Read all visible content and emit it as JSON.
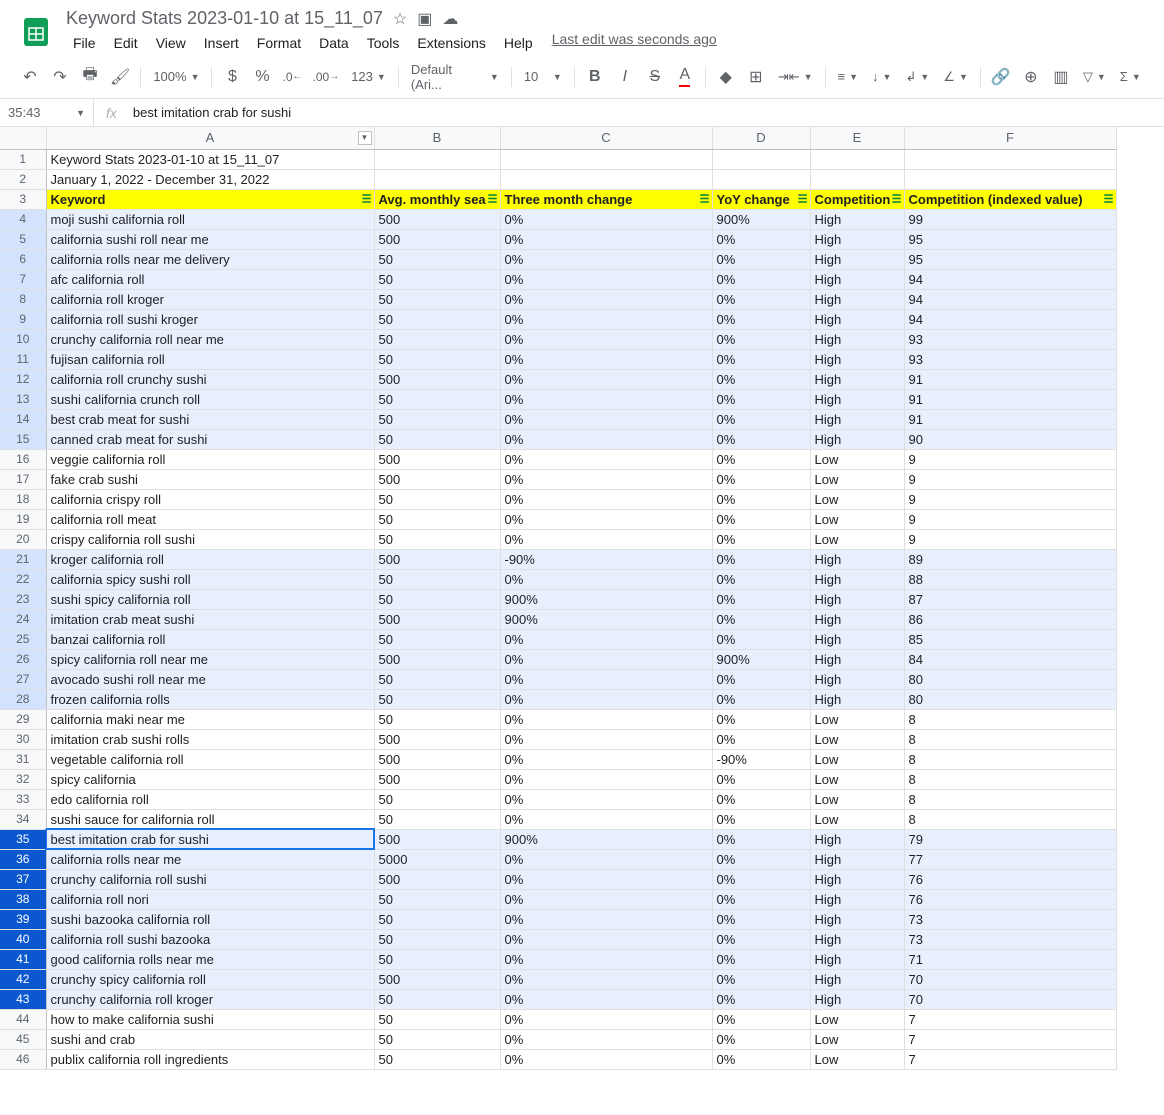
{
  "doc": {
    "title": "Keyword Stats 2023-01-10 at 15_11_07"
  },
  "menu": {
    "file": "File",
    "edit": "Edit",
    "view": "View",
    "insert": "Insert",
    "format": "Format",
    "data": "Data",
    "tools": "Tools",
    "extensions": "Extensions",
    "help": "Help",
    "last_edit": "Last edit was seconds ago"
  },
  "toolbar": {
    "zoom": "100%",
    "font": "Default (Ari...",
    "size": "10",
    "currency": "$",
    "percent": "%",
    "dec_dec": ".0",
    "dec_inc": ".00",
    "numfmt": "123"
  },
  "namebox": "35:43",
  "formula": "best imitation crab for sushi",
  "columns": [
    "A",
    "B",
    "C",
    "D",
    "E",
    "F"
  ],
  "meta_rows": [
    "Keyword Stats 2023-01-10 at 15_11_07",
    "January 1, 2022 - December 31, 2022"
  ],
  "headers": [
    "Keyword",
    "Avg. monthly sea",
    "Three month change",
    "YoY change",
    "Competition",
    "Competition (indexed value)"
  ],
  "active_cell": {
    "row": 35,
    "col": 0
  },
  "sel_rows": [
    35,
    43
  ],
  "high_rows": [
    4,
    5,
    6,
    7,
    8,
    9,
    10,
    11,
    12,
    13,
    14,
    15,
    21,
    22,
    23,
    24,
    25,
    26,
    27,
    28,
    35,
    36,
    37,
    38,
    39,
    40,
    41,
    42,
    43
  ],
  "rows": [
    {
      "n": 4,
      "c": [
        "moji sushi california roll",
        "500",
        "0%",
        "900%",
        "High",
        "99"
      ]
    },
    {
      "n": 5,
      "c": [
        "california sushi roll near me",
        "500",
        "0%",
        "0%",
        "High",
        "95"
      ]
    },
    {
      "n": 6,
      "c": [
        "california rolls near me delivery",
        "50",
        "0%",
        "0%",
        "High",
        "95"
      ]
    },
    {
      "n": 7,
      "c": [
        "afc california roll",
        "50",
        "0%",
        "0%",
        "High",
        "94"
      ]
    },
    {
      "n": 8,
      "c": [
        "california roll kroger",
        "50",
        "0%",
        "0%",
        "High",
        "94"
      ]
    },
    {
      "n": 9,
      "c": [
        "california roll sushi kroger",
        "50",
        "0%",
        "0%",
        "High",
        "94"
      ]
    },
    {
      "n": 10,
      "c": [
        "crunchy california roll near me",
        "50",
        "0%",
        "0%",
        "High",
        "93"
      ]
    },
    {
      "n": 11,
      "c": [
        "fujisan california roll",
        "50",
        "0%",
        "0%",
        "High",
        "93"
      ]
    },
    {
      "n": 12,
      "c": [
        "california roll crunchy sushi",
        "500",
        "0%",
        "0%",
        "High",
        "91"
      ]
    },
    {
      "n": 13,
      "c": [
        "sushi california crunch roll",
        "50",
        "0%",
        "0%",
        "High",
        "91"
      ]
    },
    {
      "n": 14,
      "c": [
        "best crab meat for sushi",
        "50",
        "0%",
        "0%",
        "High",
        "91"
      ]
    },
    {
      "n": 15,
      "c": [
        "canned crab meat for sushi",
        "50",
        "0%",
        "0%",
        "High",
        "90"
      ]
    },
    {
      "n": 16,
      "c": [
        "veggie california roll",
        "500",
        "0%",
        "0%",
        "Low",
        "9"
      ]
    },
    {
      "n": 17,
      "c": [
        "fake crab sushi",
        "500",
        "0%",
        "0%",
        "Low",
        "9"
      ]
    },
    {
      "n": 18,
      "c": [
        "california crispy roll",
        "50",
        "0%",
        "0%",
        "Low",
        "9"
      ]
    },
    {
      "n": 19,
      "c": [
        "california roll meat",
        "50",
        "0%",
        "0%",
        "Low",
        "9"
      ]
    },
    {
      "n": 20,
      "c": [
        "crispy california roll sushi",
        "50",
        "0%",
        "0%",
        "Low",
        "9"
      ]
    },
    {
      "n": 21,
      "c": [
        "kroger california roll",
        "500",
        "-90%",
        "0%",
        "High",
        "89"
      ]
    },
    {
      "n": 22,
      "c": [
        "california spicy sushi roll",
        "50",
        "0%",
        "0%",
        "High",
        "88"
      ]
    },
    {
      "n": 23,
      "c": [
        "sushi spicy california roll",
        "50",
        "900%",
        "0%",
        "High",
        "87"
      ]
    },
    {
      "n": 24,
      "c": [
        "imitation crab meat sushi",
        "500",
        "900%",
        "0%",
        "High",
        "86"
      ]
    },
    {
      "n": 25,
      "c": [
        "banzai california roll",
        "50",
        "0%",
        "0%",
        "High",
        "85"
      ]
    },
    {
      "n": 26,
      "c": [
        "spicy california roll near me",
        "500",
        "0%",
        "900%",
        "High",
        "84"
      ]
    },
    {
      "n": 27,
      "c": [
        "avocado sushi roll near me",
        "50",
        "0%",
        "0%",
        "High",
        "80"
      ]
    },
    {
      "n": 28,
      "c": [
        "frozen california rolls",
        "50",
        "0%",
        "0%",
        "High",
        "80"
      ]
    },
    {
      "n": 29,
      "c": [
        "california maki near me",
        "50",
        "0%",
        "0%",
        "Low",
        "8"
      ]
    },
    {
      "n": 30,
      "c": [
        "imitation crab sushi rolls",
        "500",
        "0%",
        "0%",
        "Low",
        "8"
      ]
    },
    {
      "n": 31,
      "c": [
        "vegetable california roll",
        "500",
        "0%",
        "-90%",
        "Low",
        "8"
      ]
    },
    {
      "n": 32,
      "c": [
        "spicy california",
        "500",
        "0%",
        "0%",
        "Low",
        "8"
      ]
    },
    {
      "n": 33,
      "c": [
        "edo california roll",
        "50",
        "0%",
        "0%",
        "Low",
        "8"
      ]
    },
    {
      "n": 34,
      "c": [
        "sushi sauce for california roll",
        "50",
        "0%",
        "0%",
        "Low",
        "8"
      ]
    },
    {
      "n": 35,
      "c": [
        "best imitation crab for sushi",
        "500",
        "900%",
        "0%",
        "High",
        "79"
      ]
    },
    {
      "n": 36,
      "c": [
        "california rolls near me",
        "5000",
        "0%",
        "0%",
        "High",
        "77"
      ]
    },
    {
      "n": 37,
      "c": [
        "crunchy california roll sushi",
        "500",
        "0%",
        "0%",
        "High",
        "76"
      ]
    },
    {
      "n": 38,
      "c": [
        "california roll nori",
        "50",
        "0%",
        "0%",
        "High",
        "76"
      ]
    },
    {
      "n": 39,
      "c": [
        "sushi bazooka california roll",
        "50",
        "0%",
        "0%",
        "High",
        "73"
      ]
    },
    {
      "n": 40,
      "c": [
        "california roll sushi bazooka",
        "50",
        "0%",
        "0%",
        "High",
        "73"
      ]
    },
    {
      "n": 41,
      "c": [
        "good california rolls near me",
        "50",
        "0%",
        "0%",
        "High",
        "71"
      ]
    },
    {
      "n": 42,
      "c": [
        "crunchy spicy california roll",
        "500",
        "0%",
        "0%",
        "High",
        "70"
      ]
    },
    {
      "n": 43,
      "c": [
        "crunchy california roll kroger",
        "50",
        "0%",
        "0%",
        "High",
        "70"
      ]
    },
    {
      "n": 44,
      "c": [
        "how to make california sushi",
        "50",
        "0%",
        "0%",
        "Low",
        "7"
      ]
    },
    {
      "n": 45,
      "c": [
        "sushi and crab",
        "50",
        "0%",
        "0%",
        "Low",
        "7"
      ]
    },
    {
      "n": 46,
      "c": [
        "publix california roll ingredients",
        "50",
        "0%",
        "0%",
        "Low",
        "7"
      ]
    }
  ]
}
